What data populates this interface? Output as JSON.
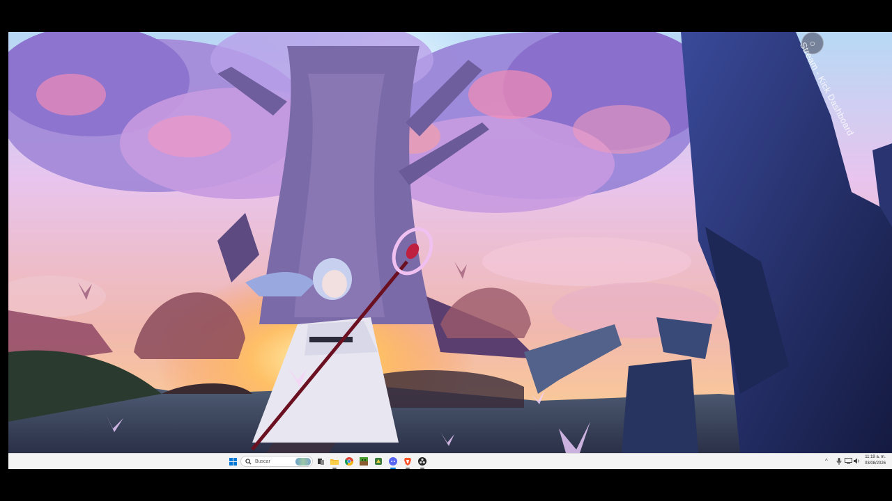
{
  "desktop": {
    "wallpaper_name": "anime-elf-tree-wallpaper",
    "side_widget": {
      "text": "Stream - Kick Dashboard",
      "icon": "circle-widget-icon"
    }
  },
  "taskbar": {
    "search": {
      "placeholder": "Buscar"
    },
    "apps": [
      {
        "name": "start-button",
        "icon": "windows-logo-icon"
      },
      {
        "name": "task-view",
        "icon": "task-view-icon"
      },
      {
        "name": "file-explorer",
        "icon": "folder-icon"
      },
      {
        "name": "chrome",
        "icon": "chrome-icon"
      },
      {
        "name": "minecraft",
        "icon": "minecraft-icon"
      },
      {
        "name": "game-app",
        "icon": "game-icon"
      },
      {
        "name": "discord",
        "icon": "discord-icon"
      },
      {
        "name": "brave",
        "icon": "brave-icon"
      },
      {
        "name": "obs",
        "icon": "obs-icon"
      }
    ],
    "tray": {
      "chevron": "^",
      "icons": [
        "microphone-icon",
        "network-icon",
        "volume-icon"
      ]
    },
    "clock": {
      "time": "11:19 a. m.",
      "date": "03/08/2026"
    }
  },
  "colors": {
    "taskbar_bg": "#f3f3f3",
    "windows_blue": "#0078d4"
  }
}
